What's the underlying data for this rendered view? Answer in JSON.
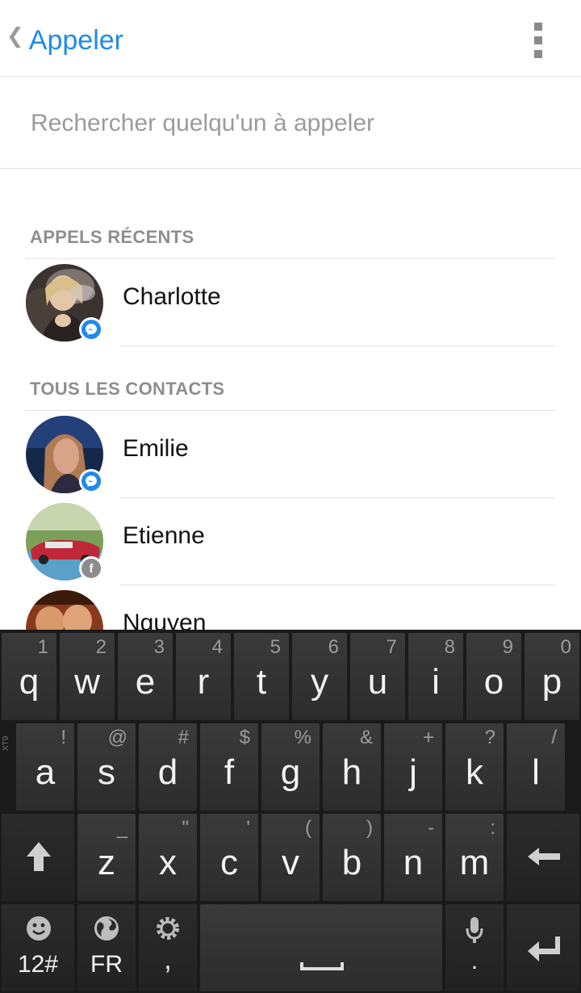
{
  "header": {
    "back_label": "Appeler",
    "back_icon": "chevron-left-icon",
    "menu_icon": "overflow-menu-icon"
  },
  "search": {
    "placeholder": "Rechercher quelqu'un à appeler",
    "value": ""
  },
  "sections": {
    "recent_title": "APPELS RÉCENTS",
    "all_title": "TOUS LES CONTACTS"
  },
  "recent": [
    {
      "name": "Charlotte",
      "badge": "messenger"
    }
  ],
  "contacts": [
    {
      "name": "Emilie",
      "badge": "messenger"
    },
    {
      "name": "Etienne",
      "badge": "facebook"
    },
    {
      "name": "Nguyen",
      "badge": ""
    }
  ],
  "keyboard": {
    "row1": [
      {
        "k": "q",
        "h": "1"
      },
      {
        "k": "w",
        "h": "2"
      },
      {
        "k": "e",
        "h": "3"
      },
      {
        "k": "r",
        "h": "4"
      },
      {
        "k": "t",
        "h": "5"
      },
      {
        "k": "y",
        "h": "6"
      },
      {
        "k": "u",
        "h": "7"
      },
      {
        "k": "i",
        "h": "8"
      },
      {
        "k": "o",
        "h": "9"
      },
      {
        "k": "p",
        "h": "0"
      }
    ],
    "row2": [
      {
        "k": "a",
        "h": "!"
      },
      {
        "k": "s",
        "h": "@"
      },
      {
        "k": "d",
        "h": "#"
      },
      {
        "k": "f",
        "h": "$"
      },
      {
        "k": "g",
        "h": "%"
      },
      {
        "k": "h",
        "h": "&"
      },
      {
        "k": "j",
        "h": "+"
      },
      {
        "k": "k",
        "h": "?"
      },
      {
        "k": "l",
        "h": "/"
      }
    ],
    "row3": [
      {
        "k": "z",
        "h": "_"
      },
      {
        "k": "x",
        "h": "\""
      },
      {
        "k": "c",
        "h": "'"
      },
      {
        "k": "v",
        "h": "("
      },
      {
        "k": "b",
        "h": ")"
      },
      {
        "k": "n",
        "h": "-"
      },
      {
        "k": "m",
        "h": ":"
      }
    ],
    "side_label": "XT9",
    "symbols_label": "12#",
    "lang_label": "FR",
    "comma_label": ",",
    "period_label": ".",
    "shift_icon": "shift-icon",
    "backspace_icon": "backspace-icon",
    "enter_icon": "enter-icon",
    "emoji_icon": "smiley-icon",
    "globe_icon": "globe-icon",
    "settings_icon": "gear-icon",
    "mic_icon": "mic-icon"
  }
}
